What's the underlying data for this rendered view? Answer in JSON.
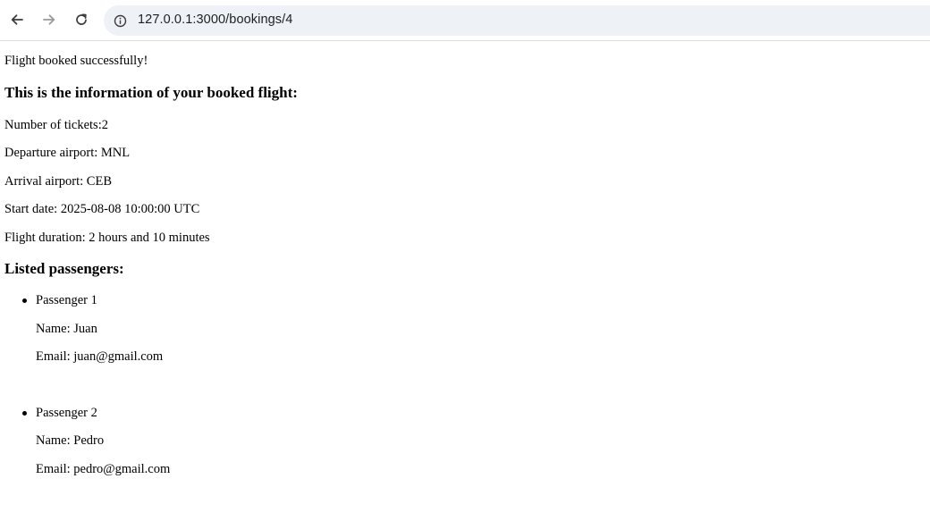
{
  "browser": {
    "url": "127.0.0.1:3000/bookings/4"
  },
  "page": {
    "notice": "Flight booked successfully!",
    "heading": "This is the information of your booked flight:",
    "tickets": "Number of tickets:2",
    "departure": "Departure airport: MNL",
    "arrival": "Arrival airport: CEB",
    "start_date": "Start date: 2025-08-08 10:00:00 UTC",
    "duration": "Flight duration: 2 hours and 10 minutes",
    "passengers_heading": "Listed passengers:",
    "passengers": [
      {
        "label": "Passenger 1",
        "name": "Name: Juan",
        "email": "Email: juan@gmail.com"
      },
      {
        "label": "Passenger 2",
        "name": "Name: Pedro",
        "email": "Email: pedro@gmail.com"
      }
    ]
  }
}
